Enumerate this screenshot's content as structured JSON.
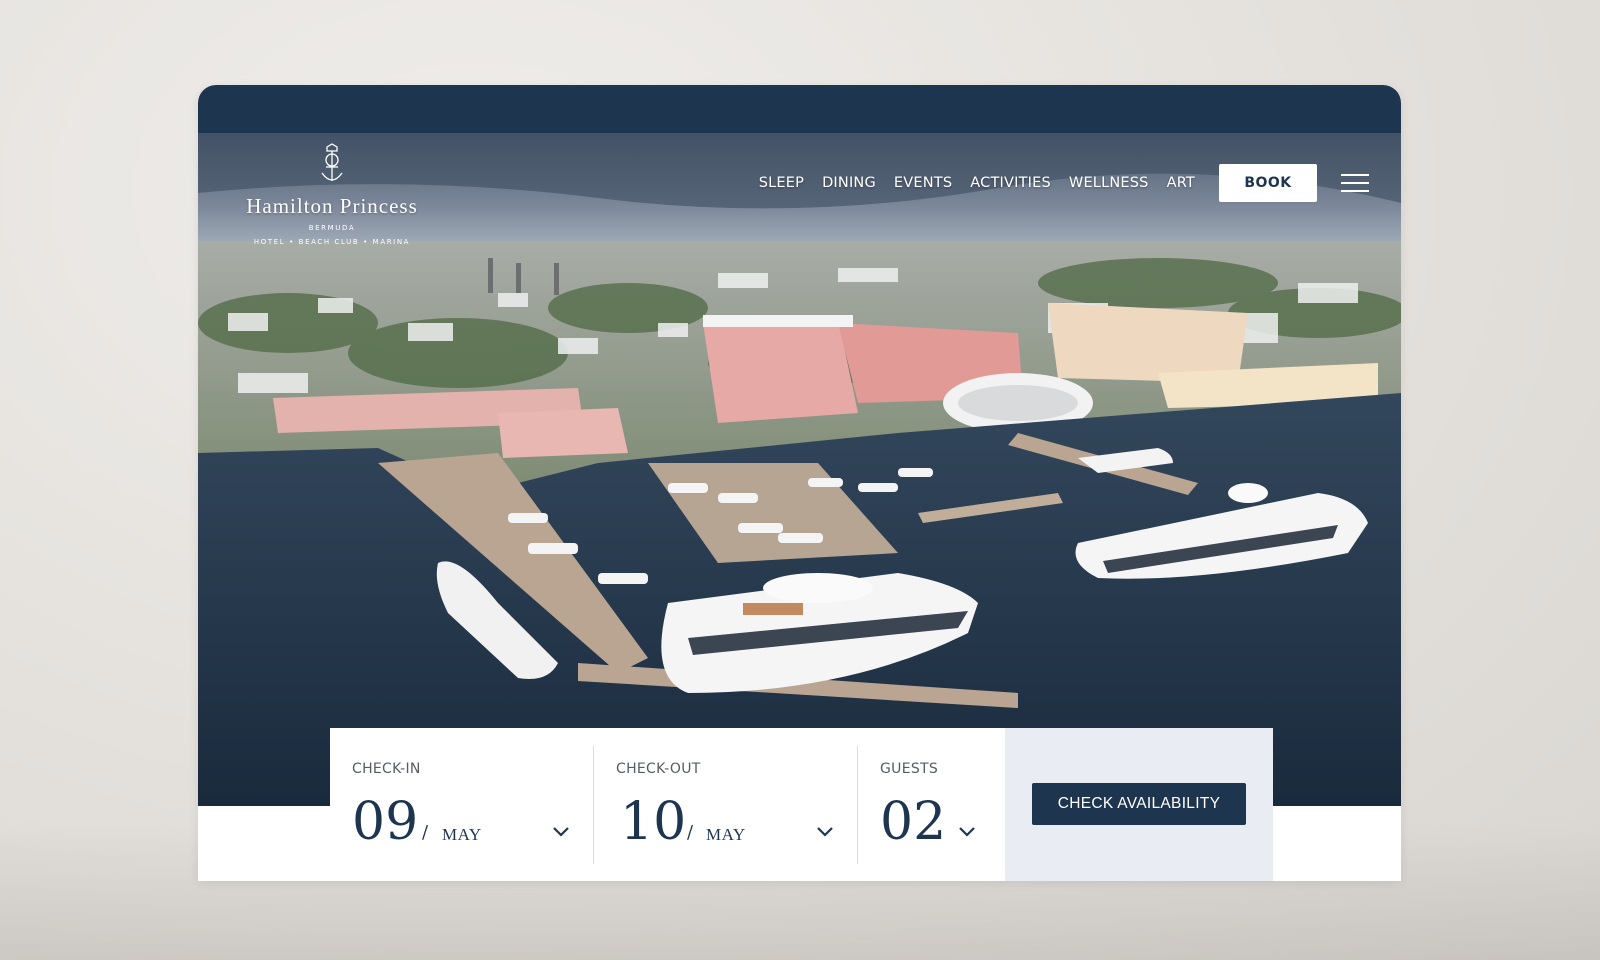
{
  "brand": {
    "name": "Hamilton Princess",
    "location": "BERMUDA",
    "tagline": "HOTEL • BEACH CLUB • MARINA"
  },
  "nav": {
    "items": [
      {
        "label": "SLEEP"
      },
      {
        "label": "DINING"
      },
      {
        "label": "EVENTS"
      },
      {
        "label": "ACTIVITIES"
      },
      {
        "label": "WELLNESS"
      },
      {
        "label": "ART"
      }
    ],
    "book_label": "BOOK",
    "menu_icon": "hamburger-menu-icon"
  },
  "booking": {
    "check_in": {
      "label": "CHECK-IN",
      "day": "09",
      "month": "MAY"
    },
    "check_out": {
      "label": "CHECK-OUT",
      "day": "10",
      "month": "MAY"
    },
    "guests": {
      "label": "GUESTS",
      "count": "02"
    },
    "submit_label": "CHECK AVAILABILITY"
  },
  "colors": {
    "navy": "#1e3550",
    "panel": "#e9edf3"
  }
}
